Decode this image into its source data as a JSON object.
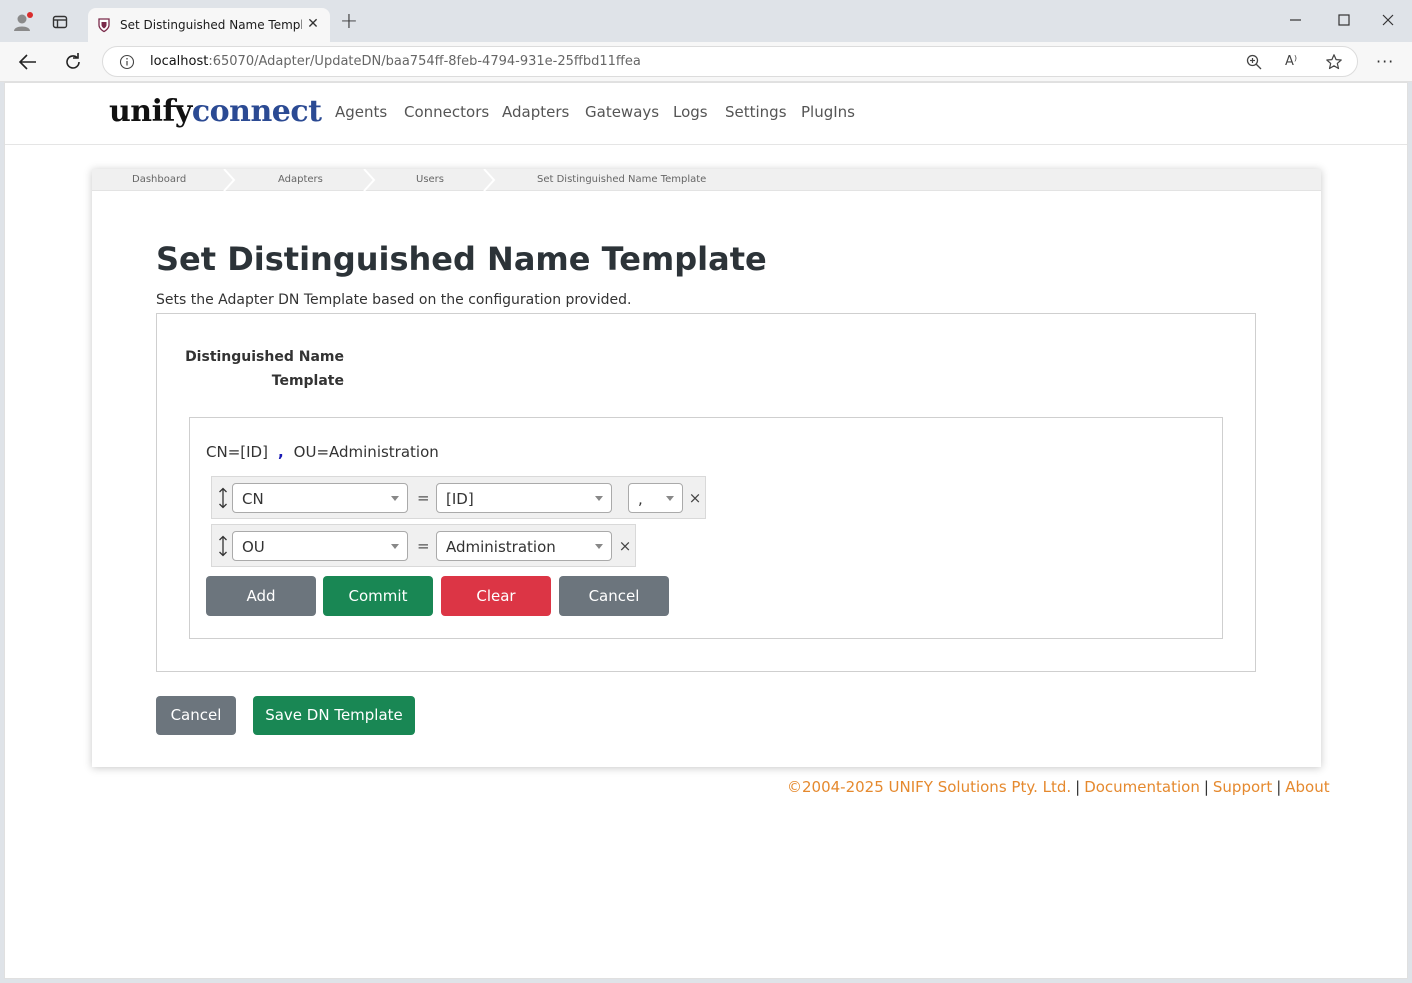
{
  "browser": {
    "tab_title": "Set Distinguished Name Template",
    "tab_close_glyph": "✕",
    "new_tab_glyph": "+",
    "url_host": "localhost",
    "url_path": ":65070/Adapter/UpdateDN/baa754ff-8feb-4794-931e-25ffbd11ffea",
    "read_aloud_glyph": "A⁾",
    "menu_glyph": "···"
  },
  "navbar": {
    "brand_part1": "unify",
    "brand_part2": "connect",
    "brand_color": "#2b4a93",
    "links": [
      "Agents",
      "Connectors",
      "Adapters",
      "Gateways",
      "Logs",
      "Settings",
      "PlugIns"
    ]
  },
  "breadcrumb": [
    "Dashboard",
    "Adapters",
    "Users",
    "Set Distinguished Name Template"
  ],
  "page": {
    "title": "Set Distinguished Name Template",
    "subtitle": "Sets the Adapter DN Template based on the configuration provided.",
    "field_label": "Distinguished Name Template"
  },
  "dn_editor": {
    "preview_part1": "CN=[ID]",
    "preview_separator": ",",
    "preview_part2": "OU=Administration",
    "rows": [
      {
        "attribute": "CN",
        "equals": "=",
        "value": "[ID]",
        "separator": ",",
        "remove": "×"
      },
      {
        "attribute": "OU",
        "equals": "=",
        "value": "Administration",
        "remove": "×"
      }
    ],
    "buttons": {
      "add": "Add",
      "commit": "Commit",
      "clear": "Clear",
      "cancel": "Cancel"
    }
  },
  "actions": {
    "cancel": "Cancel",
    "save": "Save DN Template"
  },
  "footer": {
    "copyright": "©2004-2025 UNIFY Solutions Pty. Ltd.",
    "documentation": "Documentation",
    "support": "Support",
    "about": "About",
    "divider": "|",
    "link_color": "#e5892e"
  },
  "colors": {
    "secondary": "#6c757d",
    "success": "#198754",
    "danger": "#dc3545"
  }
}
